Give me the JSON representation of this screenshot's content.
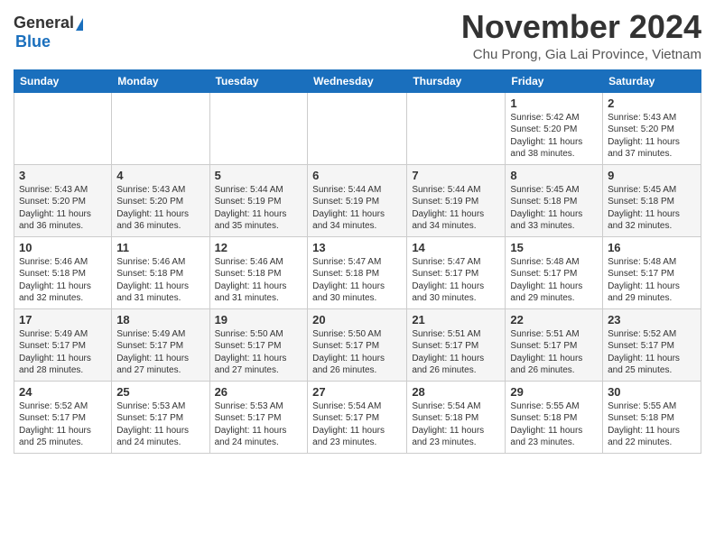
{
  "header": {
    "logo_general": "General",
    "logo_blue": "Blue",
    "month_title": "November 2024",
    "subtitle": "Chu Prong, Gia Lai Province, Vietnam"
  },
  "days_of_week": [
    "Sunday",
    "Monday",
    "Tuesday",
    "Wednesday",
    "Thursday",
    "Friday",
    "Saturday"
  ],
  "weeks": [
    [
      {
        "day": "",
        "info": ""
      },
      {
        "day": "",
        "info": ""
      },
      {
        "day": "",
        "info": ""
      },
      {
        "day": "",
        "info": ""
      },
      {
        "day": "",
        "info": ""
      },
      {
        "day": "1",
        "info": "Sunrise: 5:42 AM\nSunset: 5:20 PM\nDaylight: 11 hours\nand 38 minutes."
      },
      {
        "day": "2",
        "info": "Sunrise: 5:43 AM\nSunset: 5:20 PM\nDaylight: 11 hours\nand 37 minutes."
      }
    ],
    [
      {
        "day": "3",
        "info": "Sunrise: 5:43 AM\nSunset: 5:20 PM\nDaylight: 11 hours\nand 36 minutes."
      },
      {
        "day": "4",
        "info": "Sunrise: 5:43 AM\nSunset: 5:20 PM\nDaylight: 11 hours\nand 36 minutes."
      },
      {
        "day": "5",
        "info": "Sunrise: 5:44 AM\nSunset: 5:19 PM\nDaylight: 11 hours\nand 35 minutes."
      },
      {
        "day": "6",
        "info": "Sunrise: 5:44 AM\nSunset: 5:19 PM\nDaylight: 11 hours\nand 34 minutes."
      },
      {
        "day": "7",
        "info": "Sunrise: 5:44 AM\nSunset: 5:19 PM\nDaylight: 11 hours\nand 34 minutes."
      },
      {
        "day": "8",
        "info": "Sunrise: 5:45 AM\nSunset: 5:18 PM\nDaylight: 11 hours\nand 33 minutes."
      },
      {
        "day": "9",
        "info": "Sunrise: 5:45 AM\nSunset: 5:18 PM\nDaylight: 11 hours\nand 32 minutes."
      }
    ],
    [
      {
        "day": "10",
        "info": "Sunrise: 5:46 AM\nSunset: 5:18 PM\nDaylight: 11 hours\nand 32 minutes."
      },
      {
        "day": "11",
        "info": "Sunrise: 5:46 AM\nSunset: 5:18 PM\nDaylight: 11 hours\nand 31 minutes."
      },
      {
        "day": "12",
        "info": "Sunrise: 5:46 AM\nSunset: 5:18 PM\nDaylight: 11 hours\nand 31 minutes."
      },
      {
        "day": "13",
        "info": "Sunrise: 5:47 AM\nSunset: 5:18 PM\nDaylight: 11 hours\nand 30 minutes."
      },
      {
        "day": "14",
        "info": "Sunrise: 5:47 AM\nSunset: 5:17 PM\nDaylight: 11 hours\nand 30 minutes."
      },
      {
        "day": "15",
        "info": "Sunrise: 5:48 AM\nSunset: 5:17 PM\nDaylight: 11 hours\nand 29 minutes."
      },
      {
        "day": "16",
        "info": "Sunrise: 5:48 AM\nSunset: 5:17 PM\nDaylight: 11 hours\nand 29 minutes."
      }
    ],
    [
      {
        "day": "17",
        "info": "Sunrise: 5:49 AM\nSunset: 5:17 PM\nDaylight: 11 hours\nand 28 minutes."
      },
      {
        "day": "18",
        "info": "Sunrise: 5:49 AM\nSunset: 5:17 PM\nDaylight: 11 hours\nand 27 minutes."
      },
      {
        "day": "19",
        "info": "Sunrise: 5:50 AM\nSunset: 5:17 PM\nDaylight: 11 hours\nand 27 minutes."
      },
      {
        "day": "20",
        "info": "Sunrise: 5:50 AM\nSunset: 5:17 PM\nDaylight: 11 hours\nand 26 minutes."
      },
      {
        "day": "21",
        "info": "Sunrise: 5:51 AM\nSunset: 5:17 PM\nDaylight: 11 hours\nand 26 minutes."
      },
      {
        "day": "22",
        "info": "Sunrise: 5:51 AM\nSunset: 5:17 PM\nDaylight: 11 hours\nand 26 minutes."
      },
      {
        "day": "23",
        "info": "Sunrise: 5:52 AM\nSunset: 5:17 PM\nDaylight: 11 hours\nand 25 minutes."
      }
    ],
    [
      {
        "day": "24",
        "info": "Sunrise: 5:52 AM\nSunset: 5:17 PM\nDaylight: 11 hours\nand 25 minutes."
      },
      {
        "day": "25",
        "info": "Sunrise: 5:53 AM\nSunset: 5:17 PM\nDaylight: 11 hours\nand 24 minutes."
      },
      {
        "day": "26",
        "info": "Sunrise: 5:53 AM\nSunset: 5:17 PM\nDaylight: 11 hours\nand 24 minutes."
      },
      {
        "day": "27",
        "info": "Sunrise: 5:54 AM\nSunset: 5:17 PM\nDaylight: 11 hours\nand 23 minutes."
      },
      {
        "day": "28",
        "info": "Sunrise: 5:54 AM\nSunset: 5:18 PM\nDaylight: 11 hours\nand 23 minutes."
      },
      {
        "day": "29",
        "info": "Sunrise: 5:55 AM\nSunset: 5:18 PM\nDaylight: 11 hours\nand 23 minutes."
      },
      {
        "day": "30",
        "info": "Sunrise: 5:55 AM\nSunset: 5:18 PM\nDaylight: 11 hours\nand 22 minutes."
      }
    ]
  ]
}
